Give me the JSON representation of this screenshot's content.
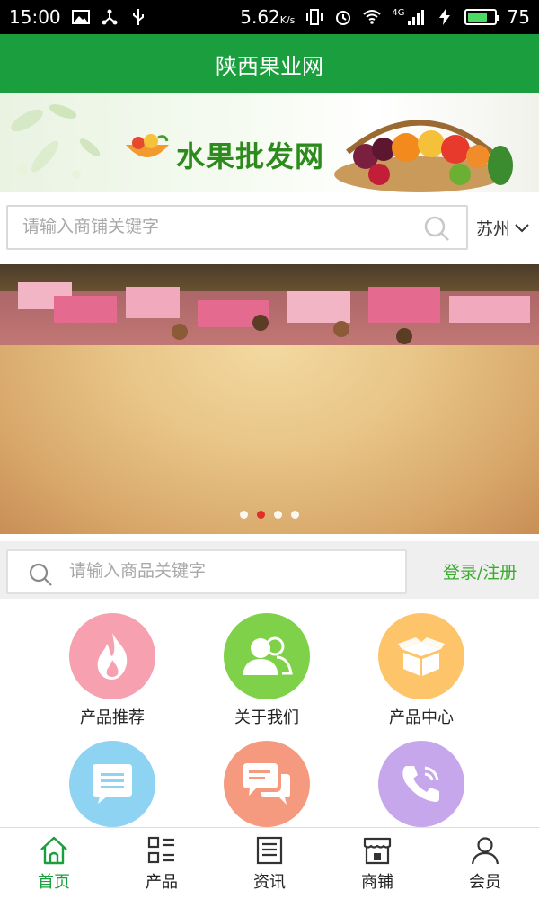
{
  "status_bar": {
    "time": "15:00",
    "speed": "5.62",
    "speed_unit": "K/s",
    "network": "4G",
    "battery": "75",
    "battery_level": 0.75
  },
  "header": {
    "title": "陕西果业网"
  },
  "banner": {
    "title": "水果批发网"
  },
  "shop_search": {
    "placeholder": "请输入商铺关键字",
    "city": "苏州"
  },
  "carousel": {
    "slide_count": 4,
    "active_index": 1
  },
  "product_search": {
    "placeholder": "请输入商品关键字",
    "login_label": "登录/注册"
  },
  "menu": {
    "items": [
      {
        "label": "产品推荐",
        "icon": "flame-icon",
        "color": "#f7a1b0"
      },
      {
        "label": "关于我们",
        "icon": "users-icon",
        "color": "#7ed148"
      },
      {
        "label": "产品中心",
        "icon": "box-icon",
        "color": "#fdc46a"
      },
      {
        "label": "",
        "icon": "message-icon",
        "color": "#8fd3f2"
      },
      {
        "label": "",
        "icon": "chat-icon",
        "color": "#f69a7f"
      },
      {
        "label": "",
        "icon": "phone-icon",
        "color": "#c7a7ec"
      }
    ]
  },
  "bottom_nav": {
    "items": [
      {
        "label": "首页",
        "icon": "home-icon",
        "active": true
      },
      {
        "label": "产品",
        "icon": "grid-list-icon",
        "active": false
      },
      {
        "label": "资讯",
        "icon": "news-icon",
        "active": false
      },
      {
        "label": "商铺",
        "icon": "store-icon",
        "active": false
      },
      {
        "label": "会员",
        "icon": "user-icon",
        "active": false
      }
    ]
  },
  "colors": {
    "brand_green": "#1b9e3e",
    "link_green": "#3aab2f",
    "active_dot": "#e02020"
  }
}
